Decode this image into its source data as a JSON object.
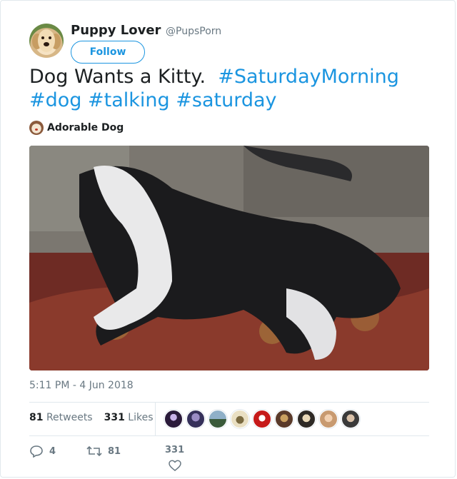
{
  "author": {
    "name": "Puppy Lover",
    "handle": "@PupsPorn",
    "avatar_icon": "golden-retriever-avatar",
    "follow_label": "Follow"
  },
  "tweet": {
    "text": "Dog Wants a Kitty.",
    "hashtags_line1": "#SaturdayMorning",
    "hashtags_line2": [
      "#dog",
      "#talking",
      "#saturday"
    ]
  },
  "attribution": {
    "name": "Adorable Dog",
    "icon": "dog-avatar-icon"
  },
  "media": {
    "description_icon": "video-thumbnail"
  },
  "timestamp": "5:11 PM - 4 Jun 2018",
  "stats": {
    "retweets_count": "81",
    "retweets_label": "Retweets",
    "likes_count": "331",
    "likes_label": "Likes",
    "likers_count": 9
  },
  "actions": {
    "reply_count": "4",
    "retweet_count": "81",
    "like_count": "331"
  },
  "colors": {
    "link": "#1b95e0",
    "muted": "#697882",
    "text": "#1c2022",
    "border": "#e1e8ed"
  }
}
